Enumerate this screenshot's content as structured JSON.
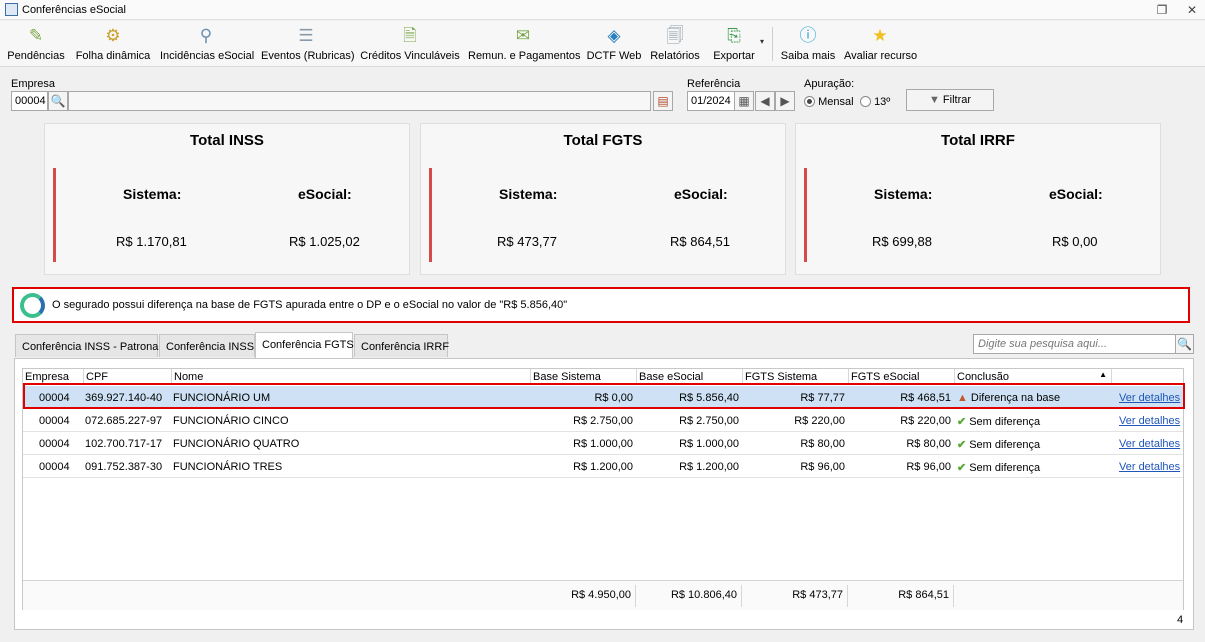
{
  "window": {
    "title": "Conferências eSocial"
  },
  "toolbar": [
    {
      "label": "Pendências",
      "icon": "pending-icon"
    },
    {
      "label": "Folha dinâmica",
      "icon": "payroll-icon"
    },
    {
      "label": "Incidências eSocial",
      "icon": "incidences-icon"
    },
    {
      "label": "Eventos (Rubricas)",
      "icon": "events-icon"
    },
    {
      "label": "Créditos Vinculáveis",
      "icon": "credits-icon"
    },
    {
      "label": "Remun. e Pagamentos",
      "icon": "payments-icon"
    },
    {
      "label": "DCTF Web",
      "icon": "dctf-icon"
    },
    {
      "label": "Relatórios",
      "icon": "reports-icon"
    },
    {
      "label": "Exportar",
      "icon": "export-icon"
    },
    {
      "label": "Saiba mais",
      "icon": "info-icon"
    },
    {
      "label": "Avaliar recurso",
      "icon": "star-icon"
    }
  ],
  "filters": {
    "empresa_label": "Empresa",
    "empresa_code": "00004",
    "empresa_name": "",
    "referencia_label": "Referência",
    "referencia_value": "01/2024",
    "apuracao_label": "Apuração:",
    "mensal_label": "Mensal",
    "decimo_label": "13º",
    "filtrar_label": "Filtrar"
  },
  "cards": [
    {
      "title": "Total INSS",
      "sistema_label": "Sistema:",
      "esocial_label": "eSocial:",
      "sistema_value": "R$ 1.170,81",
      "esocial_value": "R$ 1.025,02"
    },
    {
      "title": "Total FGTS",
      "sistema_label": "Sistema:",
      "esocial_label": "eSocial:",
      "sistema_value": "R$ 473,77",
      "esocial_value": "R$ 864,51"
    },
    {
      "title": "Total IRRF",
      "sistema_label": "Sistema:",
      "esocial_label": "eSocial:",
      "sistema_value": "R$ 699,88",
      "esocial_value": "R$ 0,00"
    }
  ],
  "message": "O segurado possui diferença na base de FGTS apurada entre o DP e o eSocial no valor de \"R$ 5.856,40\"",
  "tabs": [
    {
      "label": "Conferência INSS - Patronal"
    },
    {
      "label": "Conferência INSS"
    },
    {
      "label": "Conferência FGTS"
    },
    {
      "label": "Conferência IRRF"
    }
  ],
  "active_tab": "Conferência FGTS",
  "search": {
    "placeholder": "Digite sua pesquisa aqui..."
  },
  "grid": {
    "columns": [
      "Empresa",
      "CPF",
      "Nome",
      "Base Sistema",
      "Base eSocial",
      "FGTS Sistema",
      "FGTS eSocial",
      "Conclusão"
    ],
    "rows": [
      {
        "empresa": "00004",
        "cpf": "369.927.140-40",
        "nome": "FUNCIONÁRIO UM",
        "base_sistema": "R$ 0,00",
        "base_esocial": "R$ 5.856,40",
        "fgts_sistema": "R$ 77,77",
        "fgts_esocial": "R$ 468,51",
        "conclusao": "Diferença na base",
        "status": "warning",
        "link": "Ver detalhes"
      },
      {
        "empresa": "00004",
        "cpf": "072.685.227-97",
        "nome": "FUNCIONÁRIO CINCO",
        "base_sistema": "R$ 2.750,00",
        "base_esocial": "R$ 2.750,00",
        "fgts_sistema": "R$ 220,00",
        "fgts_esocial": "R$ 220,00",
        "conclusao": "Sem diferença",
        "status": "ok",
        "link": "Ver detalhes"
      },
      {
        "empresa": "00004",
        "cpf": "102.700.717-17",
        "nome": "FUNCIONÁRIO QUATRO",
        "base_sistema": "R$ 1.000,00",
        "base_esocial": "R$ 1.000,00",
        "fgts_sistema": "R$ 80,00",
        "fgts_esocial": "R$ 80,00",
        "conclusao": "Sem diferença",
        "status": "ok",
        "link": "Ver detalhes"
      },
      {
        "empresa": "00004",
        "cpf": "091.752.387-30",
        "nome": "FUNCIONÁRIO TRES",
        "base_sistema": "R$ 1.200,00",
        "base_esocial": "R$ 1.200,00",
        "fgts_sistema": "R$ 96,00",
        "fgts_esocial": "R$ 96,00",
        "conclusao": "Sem diferença",
        "status": "ok",
        "link": "Ver detalhes"
      }
    ],
    "totals": {
      "base_sistema": "R$ 4.950,00",
      "base_esocial": "R$ 10.806,40",
      "fgts_sistema": "R$ 473,77",
      "fgts_esocial": "R$ 864,51"
    },
    "record_count": "4"
  },
  "colors": {
    "accent_red": "#e00000",
    "card_bar": "#d84a4a",
    "selected_row": "#cfe2f5",
    "link": "#1f56b8"
  }
}
